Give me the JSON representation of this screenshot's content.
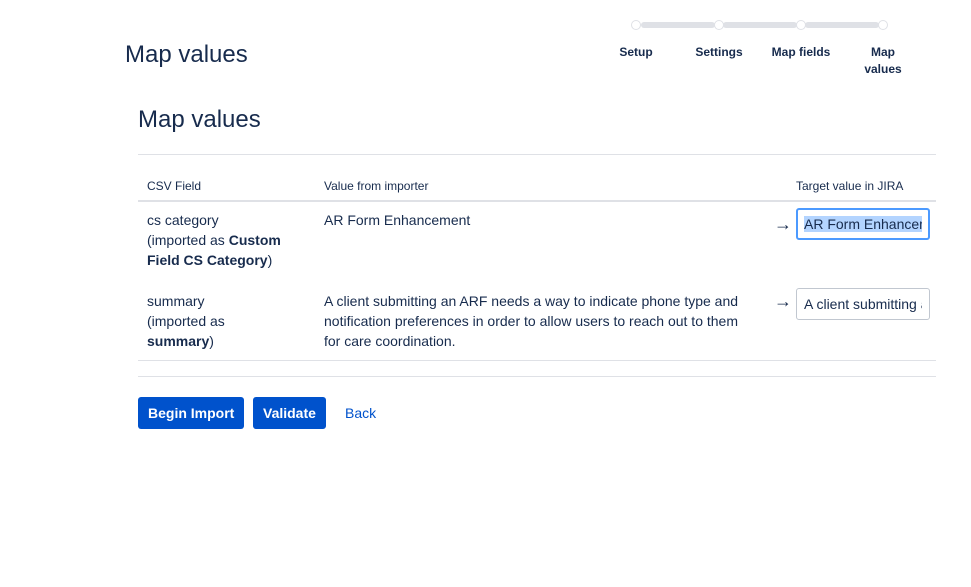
{
  "header": {
    "title": "Map values"
  },
  "tracker": {
    "steps": [
      {
        "label": "Setup"
      },
      {
        "label": "Settings"
      },
      {
        "label": "Map fields"
      },
      {
        "label": "Map values"
      }
    ]
  },
  "main": {
    "title": "Map values",
    "table": {
      "columns": [
        "CSV Field",
        "Value from importer",
        "Target value in JIRA"
      ],
      "rows": [
        {
          "field_name": "cs category",
          "imported_prefix": "(imported as ",
          "imported_as": "Custom Field CS Category",
          "imported_suffix": ")",
          "value": "AR Form Enhancement",
          "arrow": "→",
          "target": "AR Form Enhancement"
        },
        {
          "field_name": "summary",
          "imported_prefix": "(imported as ",
          "imported_as": "summary",
          "imported_suffix": ")",
          "value": "A client submitting an ARF needs a way to indicate phone type and notification preferences in order to allow users to reach out to them for care coordination.",
          "arrow": "→",
          "target": "A client submitting an ARF needs a way to indicate phone type and notification preferences in order to allow users to reach out to them for care coordination."
        }
      ]
    }
  },
  "actions": {
    "begin_import": "Begin Import",
    "validate": "Validate",
    "back": "Back"
  }
}
